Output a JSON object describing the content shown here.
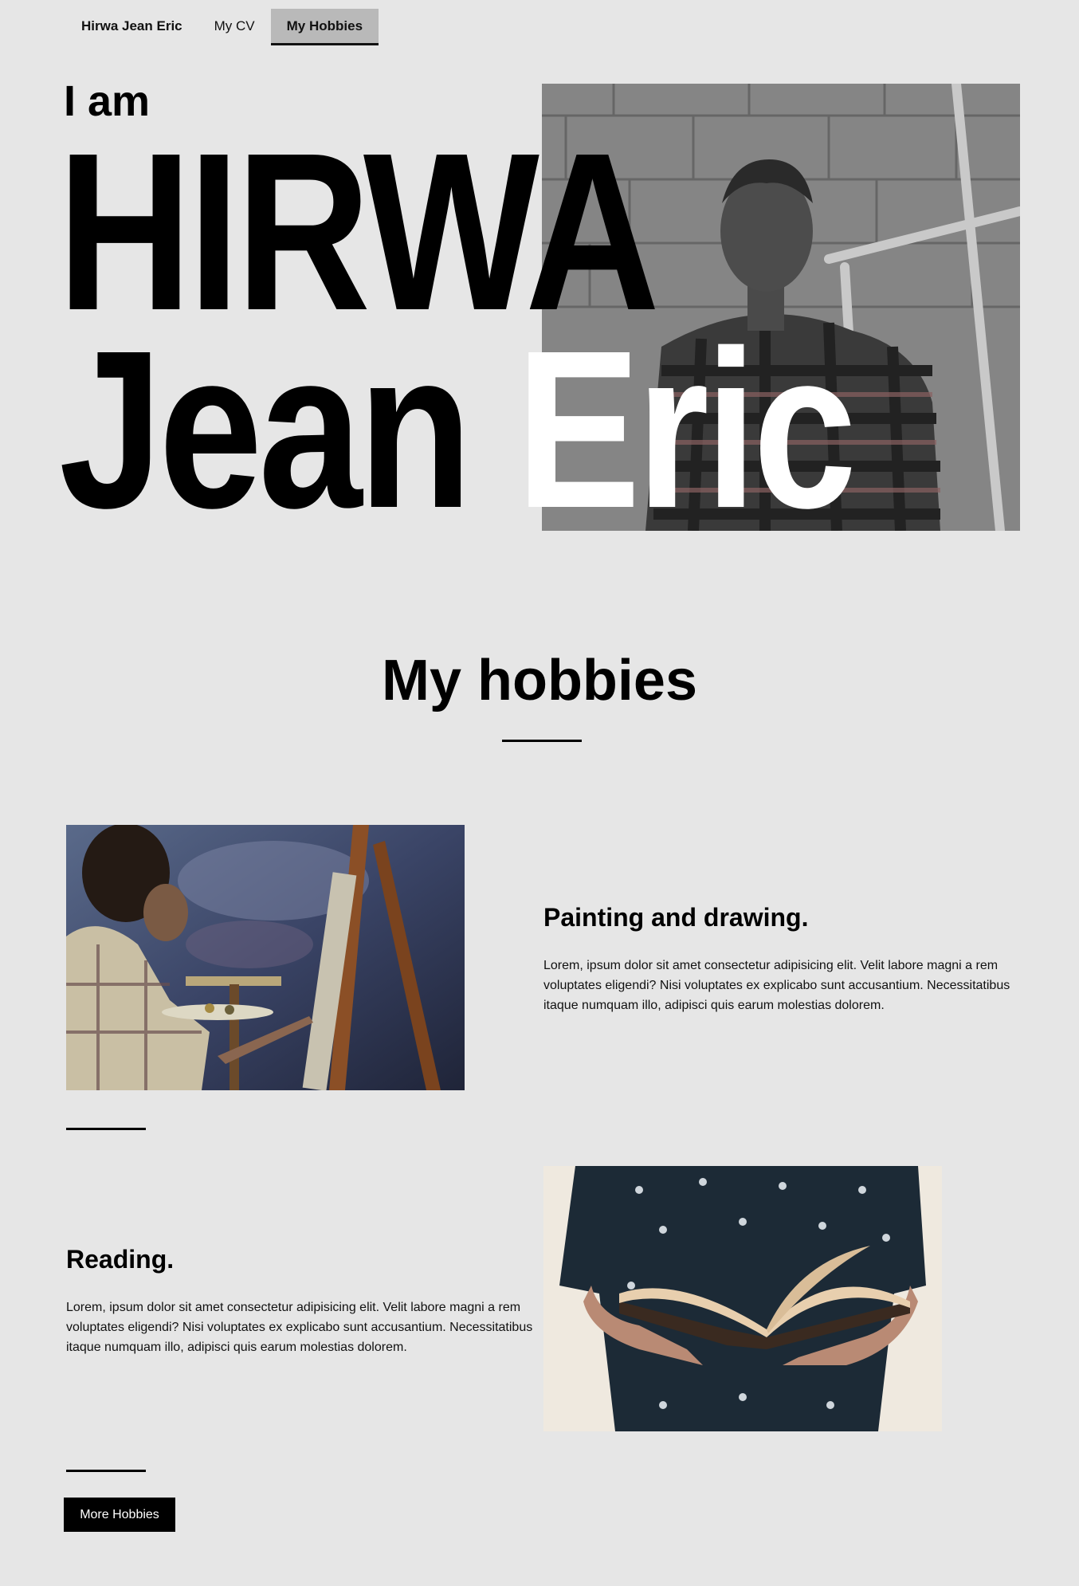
{
  "nav": {
    "brand": "Hirwa Jean Eric",
    "items": [
      {
        "label": "My CV"
      },
      {
        "label": "My Hobbies",
        "active": true
      }
    ]
  },
  "hero": {
    "intro": "I am",
    "line1": "HIRWA",
    "line2_dark": "Jean ",
    "line2_light": "Eric"
  },
  "hobbies": {
    "title": "My hobbies",
    "items": [
      {
        "title": "Painting and drawing.",
        "text": "Lorem, ipsum dolor sit amet consectetur adipisicing elit. Velit labore magni a rem voluptates eligendi? Nisi voluptates ex explicabo sunt accusantium. Necessitatibus itaque numquam illo, adipisci quis earum molestias dolorem."
      },
      {
        "title": "Reading.",
        "text": "Lorem, ipsum dolor sit amet consectetur adipisicing elit. Velit labore magni a rem voluptates eligendi? Nisi voluptates ex explicabo sunt accusantium. Necessitatibus itaque numquam illo, adipisci quis earum molestias dolorem."
      }
    ],
    "more_button": "More Hobbies"
  }
}
